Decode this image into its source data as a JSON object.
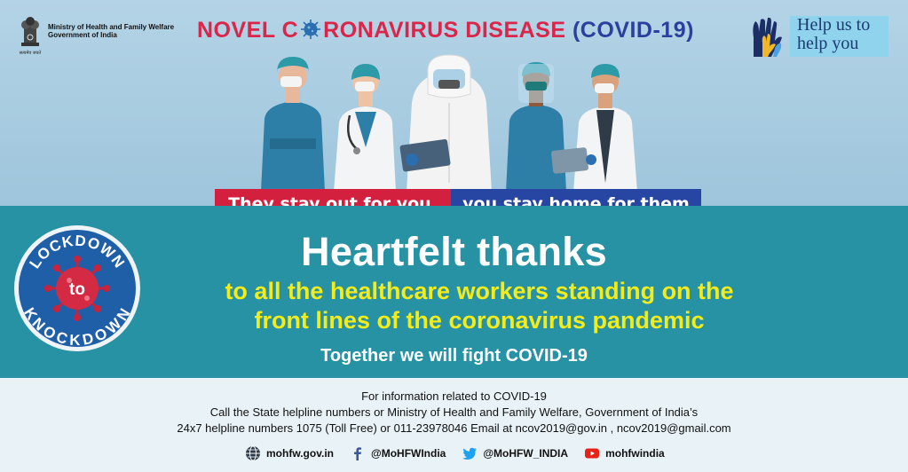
{
  "ministry": {
    "line1": "Ministry of Health and Family Welfare",
    "line2": "Government of India",
    "emblem_caption": "सत्यमेव जयते"
  },
  "headline": {
    "part1": "NOVEL C",
    "part2": "RONAVIRUS DISEASE",
    "part3": "(COVID-19)"
  },
  "help": {
    "line1": "Help us to",
    "line2": "help you"
  },
  "tagline": {
    "left": "They stay out for you,",
    "right": "you stay home for them"
  },
  "badge": {
    "top": "LOCKDOWN",
    "middle": "to",
    "bottom": "KNOCKDOWN"
  },
  "main": {
    "title": "Heartfelt thanks",
    "line1": "to all the healthcare workers standing on the",
    "line2": "front lines of the coronavirus pandemic",
    "together": "Together we will fight COVID-19"
  },
  "info": {
    "line1": "For information related to COVID-19",
    "line2": "Call the State helpline numbers or Ministry of Health and Family Welfare, Government of India’s",
    "line3": "24x7 helpline numbers 1075 (Toll Free) or 011-23978046 Email at ncov2019@gov.in , ncov2019@gmail.com"
  },
  "social": {
    "web": "mohfw.gov.in",
    "facebook": "@MoHFWIndia",
    "twitter": "@MoHFW_INDIA",
    "youtube": "mohfwindia"
  },
  "colors": {
    "red": "#d4203f",
    "blue": "#2746a3",
    "teal": "#2792a4",
    "yellow": "#f3ec1c"
  }
}
